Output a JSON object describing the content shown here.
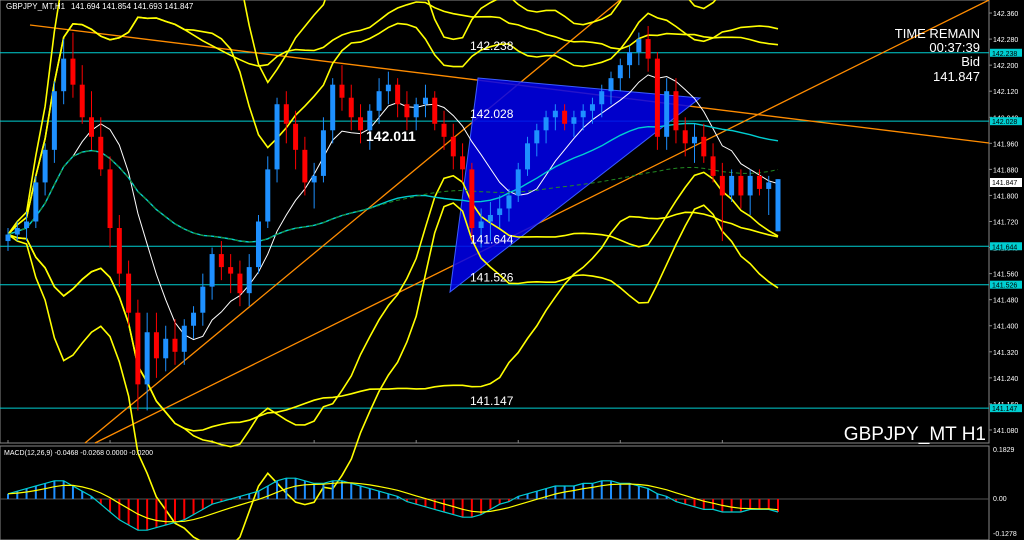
{
  "header": {
    "symbol_tf": "GBPJPY_MT,H1",
    "ohlc": "141.694 141.854 141.693 141.847"
  },
  "info": {
    "time_label": "TIME REMAIN",
    "time_value": "00:37:39",
    "bid_label": "Bid",
    "bid_value": "141.847"
  },
  "watermark": "GBPJPY_MT H1",
  "macd_label": "MACD(12,26,9) -0.0468 -0.0268 0.0000 -0.0200",
  "macd_scale": [
    "0.1829",
    "0.00",
    "-0.1278"
  ],
  "levels": [
    {
      "label": "142.238",
      "value": 142.238
    },
    {
      "label": "142.028",
      "value": 142.028
    },
    {
      "label": "141.644",
      "value": 141.644
    },
    {
      "label": "141.526",
      "value": 141.526
    },
    {
      "label": "141.147",
      "value": 141.147
    }
  ],
  "annotation": "142.011",
  "current_price_tag": "141.847",
  "colors": {
    "background": "#000000",
    "bull": "#1e90ff",
    "bear": "#ff0000",
    "level_line": "#00ced1",
    "bollinger": "#ffff00",
    "trend": "#ff8c00",
    "triangle": "#0000ff",
    "ma_fast": "#ffffff",
    "ma_slow": "#00ced1",
    "macd_signal": "#ffff00",
    "macd_main": "#00ced1"
  },
  "chart_data": {
    "type": "candlestick",
    "title": "GBPJPY_MT H1",
    "y_axis_ticks": [
      "142.360",
      "142.280",
      "142.200",
      "142.120",
      "142.040",
      "141.960",
      "141.880",
      "141.800",
      "141.720",
      "141.640",
      "141.560",
      "141.480",
      "141.400",
      "141.320",
      "141.240",
      "141.160",
      "141.080"
    ],
    "ylim": [
      141.04,
      142.4
    ],
    "candles": [
      [
        141.66,
        141.7,
        141.63,
        141.68
      ],
      [
        141.68,
        141.72,
        141.66,
        141.7
      ],
      [
        141.7,
        141.75,
        141.66,
        141.72
      ],
      [
        141.72,
        141.86,
        141.7,
        141.84
      ],
      [
        141.84,
        141.96,
        141.8,
        141.94
      ],
      [
        141.94,
        142.15,
        141.9,
        142.12
      ],
      [
        142.12,
        142.28,
        142.08,
        142.22
      ],
      [
        142.22,
        142.3,
        142.1,
        142.14
      ],
      [
        142.14,
        142.2,
        142.02,
        142.04
      ],
      [
        142.04,
        142.12,
        141.94,
        141.98
      ],
      [
        141.98,
        142.04,
        141.86,
        141.88
      ],
      [
        141.88,
        141.92,
        141.64,
        141.7
      ],
      [
        141.7,
        141.74,
        141.52,
        141.56
      ],
      [
        141.56,
        141.6,
        141.4,
        141.44
      ],
      [
        141.44,
        141.48,
        141.14,
        141.22
      ],
      [
        141.22,
        141.44,
        141.14,
        141.38
      ],
      [
        141.38,
        141.44,
        141.24,
        141.3
      ],
      [
        141.3,
        141.4,
        141.26,
        141.36
      ],
      [
        141.36,
        141.42,
        141.28,
        141.32
      ],
      [
        141.32,
        141.42,
        141.28,
        141.4
      ],
      [
        141.4,
        141.46,
        141.36,
        141.44
      ],
      [
        141.44,
        141.56,
        141.4,
        141.52
      ],
      [
        141.52,
        141.64,
        141.48,
        141.62
      ],
      [
        141.62,
        141.66,
        141.54,
        141.58
      ],
      [
        141.58,
        141.62,
        141.5,
        141.56
      ],
      [
        141.56,
        141.6,
        141.46,
        141.5
      ],
      [
        141.5,
        141.62,
        141.46,
        141.58
      ],
      [
        141.58,
        141.74,
        141.56,
        141.72
      ],
      [
        141.72,
        141.92,
        141.7,
        141.88
      ],
      [
        141.88,
        142.1,
        141.84,
        142.08
      ],
      [
        142.08,
        142.12,
        141.96,
        142.02
      ],
      [
        142.02,
        142.06,
        141.88,
        141.94
      ],
      [
        141.94,
        141.98,
        141.8,
        141.84
      ],
      [
        141.84,
        141.9,
        141.76,
        141.86
      ],
      [
        141.86,
        142.04,
        141.84,
        142.0
      ],
      [
        142.0,
        142.16,
        141.96,
        142.14
      ],
      [
        142.14,
        142.2,
        142.06,
        142.1
      ],
      [
        142.1,
        142.14,
        142.0,
        142.04
      ],
      [
        142.04,
        142.08,
        141.96,
        142.0
      ],
      [
        142.0,
        142.08,
        141.94,
        142.06
      ],
      [
        142.06,
        142.16,
        142.02,
        142.12
      ],
      [
        142.12,
        142.18,
        142.08,
        142.14
      ],
      [
        142.14,
        142.16,
        142.04,
        142.08
      ],
      [
        142.08,
        142.12,
        142.0,
        142.04
      ],
      [
        142.04,
        142.1,
        142.0,
        142.08
      ],
      [
        142.08,
        142.14,
        142.04,
        142.1
      ],
      [
        142.1,
        142.12,
        142.0,
        142.02
      ],
      [
        142.02,
        142.06,
        141.94,
        141.98
      ],
      [
        141.98,
        142.02,
        141.88,
        141.92
      ],
      [
        141.92,
        141.96,
        141.84,
        141.88
      ],
      [
        141.88,
        141.9,
        141.66,
        141.7
      ],
      [
        141.7,
        141.76,
        141.64,
        141.72
      ],
      [
        141.72,
        141.78,
        141.66,
        141.74
      ],
      [
        141.74,
        141.8,
        141.7,
        141.76
      ],
      [
        141.76,
        141.82,
        141.72,
        141.8
      ],
      [
        141.8,
        141.9,
        141.78,
        141.88
      ],
      [
        141.88,
        141.98,
        141.86,
        141.96
      ],
      [
        141.96,
        142.02,
        141.92,
        142.0
      ],
      [
        142.0,
        142.06,
        141.96,
        142.04
      ],
      [
        142.04,
        142.08,
        142.0,
        142.06
      ],
      [
        142.06,
        142.08,
        142.0,
        142.02
      ],
      [
        142.02,
        142.06,
        141.98,
        142.04
      ],
      [
        142.04,
        142.08,
        142.0,
        142.06
      ],
      [
        142.06,
        142.1,
        142.02,
        142.08
      ],
      [
        142.08,
        142.14,
        142.04,
        142.12
      ],
      [
        142.12,
        142.18,
        142.08,
        142.16
      ],
      [
        142.16,
        142.22,
        142.12,
        142.2
      ],
      [
        142.2,
        142.26,
        142.16,
        142.24
      ],
      [
        142.24,
        142.3,
        142.2,
        142.28
      ],
      [
        142.28,
        142.32,
        142.18,
        142.22
      ],
      [
        142.22,
        142.24,
        141.94,
        141.98
      ],
      [
        141.98,
        142.16,
        141.94,
        142.12
      ],
      [
        142.12,
        142.16,
        141.96,
        142.0
      ],
      [
        142.0,
        142.04,
        141.92,
        141.96
      ],
      [
        141.96,
        142.02,
        141.9,
        141.98
      ],
      [
        141.98,
        142.02,
        141.9,
        141.92
      ],
      [
        141.92,
        141.96,
        141.84,
        141.86
      ],
      [
        141.86,
        141.9,
        141.66,
        141.8
      ],
      [
        141.8,
        141.88,
        141.78,
        141.86
      ],
      [
        141.86,
        141.88,
        141.76,
        141.8
      ],
      [
        141.8,
        141.88,
        141.74,
        141.86
      ],
      [
        141.86,
        141.88,
        141.8,
        141.82
      ],
      [
        141.82,
        141.86,
        141.74,
        141.84
      ],
      [
        141.69,
        141.85,
        141.69,
        141.85
      ]
    ],
    "macd_histogram": [
      0.02,
      0.03,
      0.04,
      0.05,
      0.06,
      0.07,
      0.07,
      0.05,
      0.03,
      0.01,
      -0.02,
      -0.05,
      -0.08,
      -0.1,
      -0.12,
      -0.12,
      -0.11,
      -0.1,
      -0.09,
      -0.08,
      -0.06,
      -0.04,
      -0.02,
      -0.01,
      0.0,
      0.01,
      0.02,
      0.03,
      0.05,
      0.07,
      0.08,
      0.08,
      0.07,
      0.06,
      0.06,
      0.07,
      0.07,
      0.06,
      0.05,
      0.04,
      0.03,
      0.02,
      0.01,
      -0.01,
      -0.02,
      -0.03,
      -0.04,
      -0.05,
      -0.06,
      -0.07,
      -0.07,
      -0.06,
      -0.04,
      -0.02,
      -0.01,
      0.01,
      0.02,
      0.03,
      0.04,
      0.05,
      0.05,
      0.05,
      0.06,
      0.06,
      0.07,
      0.07,
      0.06,
      0.06,
      0.05,
      0.04,
      0.02,
      0.01,
      -0.01,
      -0.02,
      -0.03,
      -0.04,
      -0.04,
      -0.05,
      -0.05,
      -0.05,
      -0.04,
      -0.04,
      -0.04,
      -0.05
    ]
  }
}
